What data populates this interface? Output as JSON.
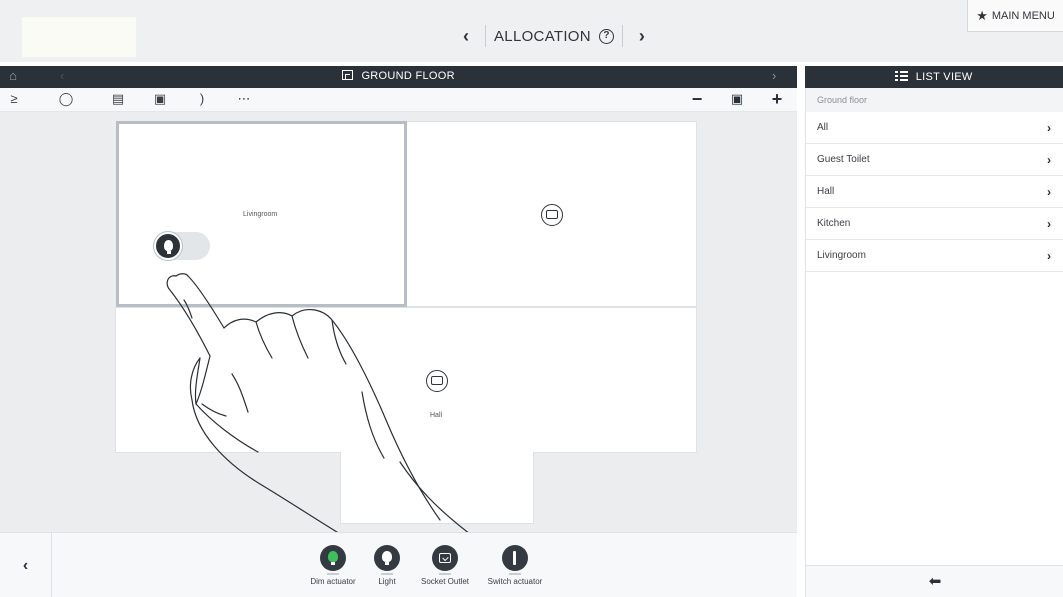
{
  "header": {
    "title": "ALLOCATION",
    "prev_icon": "chevron-left-icon",
    "next_icon": "chevron-right-icon",
    "help_icon": "help-circle-icon",
    "main_menu_label": "MAIN MENU",
    "main_menu_icon": "star-icon"
  },
  "floorplan": {
    "title": "GROUND FLOOR",
    "rooms": [
      {
        "label": "Livingroom"
      },
      {
        "label": "Hall"
      }
    ]
  },
  "tools": [
    "sensor-icon",
    "lightbulb-icon",
    "blind-icon",
    "door-icon",
    "wireless-icon",
    "more-icon"
  ],
  "devices": [
    {
      "label": "Dim actuator",
      "icon": "dim-bulb-icon"
    },
    {
      "label": "Light",
      "icon": "bulb-icon"
    },
    {
      "label": "Socket Outlet",
      "icon": "socket-icon"
    },
    {
      "label": "Switch actuator",
      "icon": "switch-icon"
    }
  ],
  "list_view": {
    "title": "LIST VIEW",
    "subtitle": "Ground floor",
    "items": [
      {
        "label": "All"
      },
      {
        "label": "Guest Toilet"
      },
      {
        "label": "Hall"
      },
      {
        "label": "Kitchen"
      },
      {
        "label": "Livingroom"
      }
    ]
  },
  "colors": {
    "dark_bar": "#2b3138",
    "canvas": "#ebedef",
    "dim_accent": "#3fbf5b"
  }
}
